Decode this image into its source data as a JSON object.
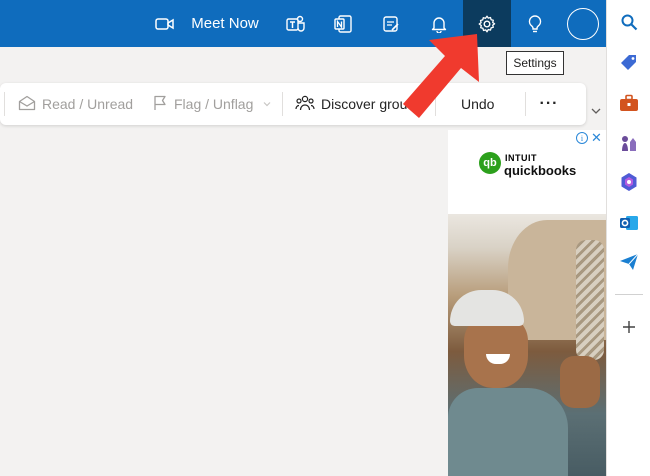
{
  "header": {
    "meet_now_label": "Meet Now",
    "icons": [
      "video-camera-icon",
      "teams-icon",
      "onenote-icon",
      "todo-icon",
      "bell-icon",
      "gear-icon",
      "lightbulb-icon",
      "avatar"
    ],
    "bg_color": "#0f6cbd",
    "active_bg_color": "#0c3b5e"
  },
  "tooltip": {
    "text": "Settings"
  },
  "toolbar": {
    "read_unread": "Read / Unread",
    "flag_unflag": "Flag / Unflag",
    "discover_groups": "Discover grou",
    "undo": "Undo",
    "more": "···"
  },
  "ad": {
    "brand_top": "INTUIT",
    "brand_name": "quickbooks",
    "logo_text": "qb",
    "info": "i",
    "close": "✕",
    "brand_color": "#2ca01c"
  },
  "rail": {
    "icons": [
      "search-icon",
      "tag-icon",
      "briefcase-icon",
      "chess-icon",
      "copilot-icon",
      "outlook-icon",
      "send-icon",
      "add-icon"
    ]
  },
  "annotation": {
    "color": "#f03a2e"
  }
}
